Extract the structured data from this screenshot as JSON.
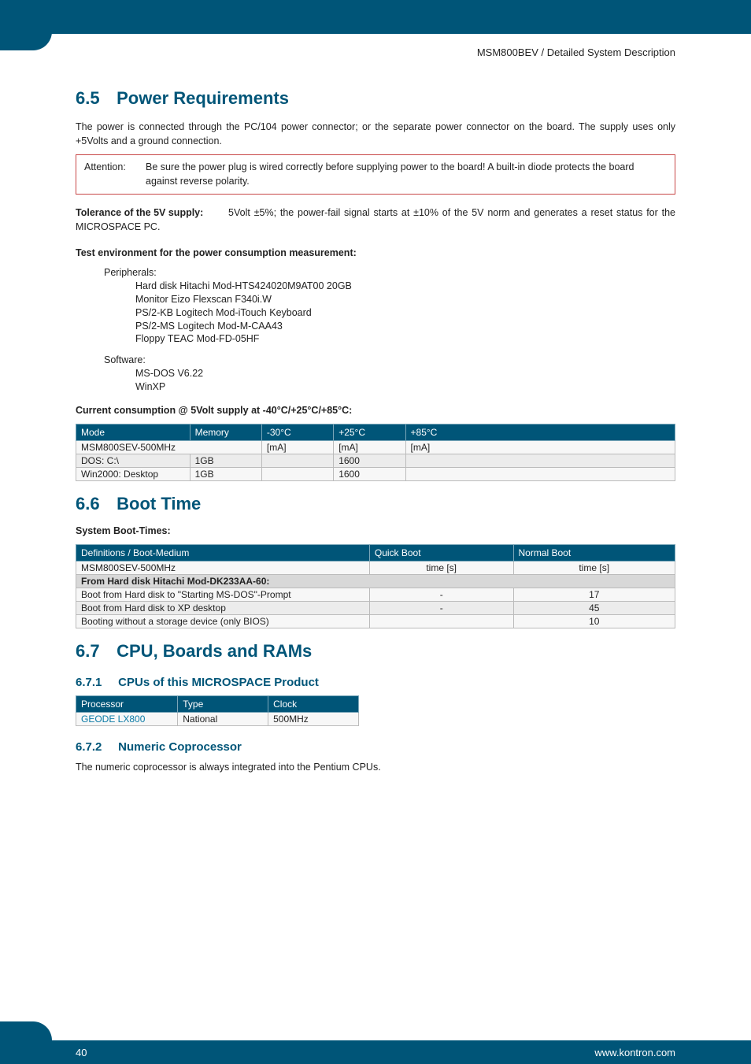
{
  "running_head": "MSM800BEV / Detailed System Description",
  "sec65": {
    "num": "6.5",
    "title": "Power Requirements",
    "intro": "The power is connected through the PC/104 power connector; or the separate power connector on the board. The supply uses only +5Volts and a ground connection.",
    "attention_label": "Attention:",
    "attention_text": "Be sure the power plug is wired correctly before supplying power to the board! A built-in diode protects the board against reverse polarity.",
    "tolerance_label": "Tolerance of the 5V supply:",
    "tolerance_text": "5Volt ±5%; the power-fail signal starts at ±10% of the 5V norm and generates a reset status for the MICROSPACE PC.",
    "test_env_head": "Test environment for the power consumption measurement:",
    "peripherals_label": "Peripherals:",
    "peripherals": [
      "Hard disk Hitachi Mod-HTS424020M9AT00 20GB",
      "Monitor Eizo Flexscan F340i.W",
      "PS/2-KB Logitech Mod-iTouch Keyboard",
      "PS/2-MS Logitech Mod-M-CAA43",
      "Floppy TEAC Mod-FD-05HF"
    ],
    "software_label": "Software:",
    "software": [
      "MS-DOS V6.22",
      "WinXP"
    ],
    "consumption_head": "Current consumption @ 5Volt supply at -40°C/+25°C/+85°C:",
    "table": {
      "headers": [
        "Mode",
        "Memory",
        "-30°C",
        "+25°C",
        "+85°C"
      ],
      "rows": [
        [
          "MSM800SEV-500MHz",
          "",
          "[mA]",
          "[mA]",
          "[mA]"
        ],
        [
          "DOS: C:\\",
          "1GB",
          "",
          "1600",
          ""
        ],
        [
          "Win2000: Desktop",
          "1GB",
          "",
          "1600",
          ""
        ]
      ]
    }
  },
  "sec66": {
    "num": "6.6",
    "title": "Boot Time",
    "sub": "System Boot-Times:",
    "table": {
      "headers": [
        "Definitions / Boot-Medium",
        "Quick Boot",
        "Normal Boot"
      ],
      "row1": [
        "MSM800SEV-500MHz",
        "time [s]",
        "time [s]"
      ],
      "subhead": "From Hard disk Hitachi Mod-DK233AA-60:",
      "rows": [
        [
          "Boot from Hard disk to \"Starting MS-DOS\"-Prompt",
          "-",
          "17"
        ],
        [
          "Boot from Hard disk to XP desktop",
          "-",
          "45"
        ],
        [
          "Booting without a storage device (only BIOS)",
          "",
          "10"
        ]
      ]
    }
  },
  "sec67": {
    "num": "6.7",
    "title": "CPU, Boards and RAMs",
    "s671": {
      "num": "6.7.1",
      "title": "CPUs of this MICROSPACE Product",
      "table": {
        "headers": [
          "Processor",
          "Type",
          "Clock"
        ],
        "row": [
          "GEODE LX800",
          "National",
          "500MHz"
        ]
      }
    },
    "s672": {
      "num": "6.7.2",
      "title": "Numeric Coprocessor",
      "text": "The numeric coprocessor is always integrated into the Pentium CPUs."
    }
  },
  "footer": {
    "page": "40",
    "url": "www.kontron.com"
  }
}
